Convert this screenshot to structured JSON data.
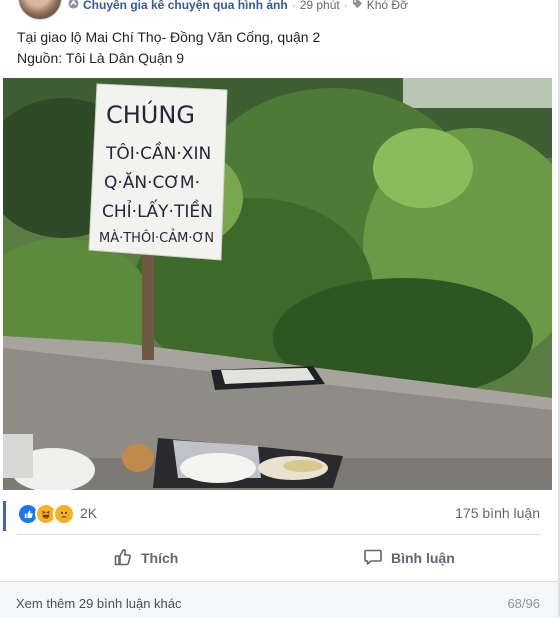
{
  "header": {
    "group_name": "Chuyên gia kê chuyện qua hình ảnh",
    "time": "29 phút",
    "tag": "Khó Đỡ",
    "separator": "·"
  },
  "post": {
    "line1": "Tại giao lộ Mai Chí Thọ- Đồng Văn Cống, quận 2",
    "line2": "Nguồn: Tôi Là Dân Quận 9"
  },
  "photo": {
    "sign_lines": [
      "CHÚNG",
      "TÔI·CẦN·XIN",
      "Q·ĂN·CƠM·",
      "CHỈ·LẤY·TIỀN",
      "MÀ·THÔI·CẢM·ƠN"
    ]
  },
  "reactions": {
    "icons": [
      "like-icon",
      "haha-icon",
      "sad-icon"
    ],
    "count": "2K",
    "comments": "175 bình luận"
  },
  "actions": {
    "like_label": "Thích",
    "comment_label": "Bình luận"
  },
  "footer": {
    "more_comments": "Xem thêm 29 bình luận khác",
    "page_count": "68/96"
  },
  "colors": {
    "link": "#385898",
    "like_blue": "#1877f2",
    "haha_yellow": "#f7b125",
    "muted": "#606770"
  }
}
